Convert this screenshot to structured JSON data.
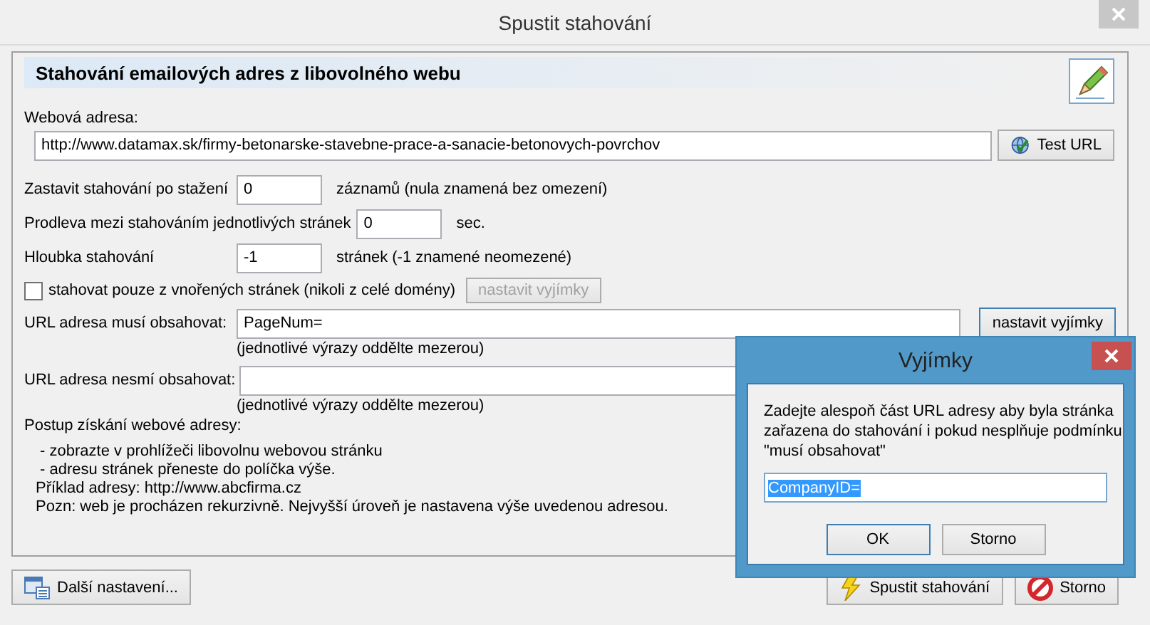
{
  "window": {
    "title": "Spustit stahování"
  },
  "panel": {
    "title": "Stahování emailových adres z libovolného webu"
  },
  "url": {
    "label": "Webová adresa:",
    "value": "http://www.datamax.sk/firmy-betonarske-stavebne-prace-a-sanacie-betonovych-povrchov",
    "button": "Test URL"
  },
  "settings": [
    {
      "label": "Zastavit stahování po stažení",
      "value": "0",
      "suffix": "záznamů (nula znamená bez omezení)"
    },
    {
      "label": "Prodleva mezi stahováním jednotlivých stránek",
      "value": "0",
      "suffix": "sec."
    },
    {
      "label": "Hloubka stahování",
      "value": "-1",
      "suffix": "stránek (-1 znamené neomezené)"
    }
  ],
  "subpages": {
    "label": "stahovat pouze z vnořených stránek (nikoli z celé domény)",
    "checked": false,
    "button": "nastavit vyjímky",
    "button_disabled": true
  },
  "filters": [
    {
      "label": "URL adresa musí obsahovat:",
      "value": "PageNum=",
      "hint": "(jednotlivé výrazy oddělte mezerou)",
      "button": "nastavit vyjímky"
    },
    {
      "label": "URL adresa nesmí obsahovat:",
      "hint": "(jednotlivé výrazy oddělte mezerou)"
    }
  ],
  "instructions": {
    "heading": "Postup získání webové adresy:",
    "lines": [
      " - zobrazte v prohlížeči libovolnu webovou stránku",
      " - adresu stránek přeneste do políčka výše.",
      "Příklad adresy: http://www.abcfirma.cz",
      "Pozn: web je procházen rekurzivně. Nejvyšší úroveň je nastavena výše uvedenou adresou."
    ]
  },
  "footer": {
    "left": {
      "kind": "settings",
      "label": "Další nastavení..."
    },
    "right": [
      {
        "kind": "start",
        "label": "Spustit stahování"
      },
      {
        "kind": "cancel",
        "label": "Storno"
      }
    ]
  },
  "dialog": {
    "title": "Vyjímky",
    "message": "Zadejte alespoň část URL adresy aby byla stránka zařazena do stahování i pokud nesplňuje podmínku \"musí obsahovat\"",
    "value": "CompanyID=",
    "value_selected": true,
    "buttons": [
      {
        "label": "OK",
        "default": true
      },
      {
        "label": "Storno",
        "default": false
      }
    ]
  }
}
